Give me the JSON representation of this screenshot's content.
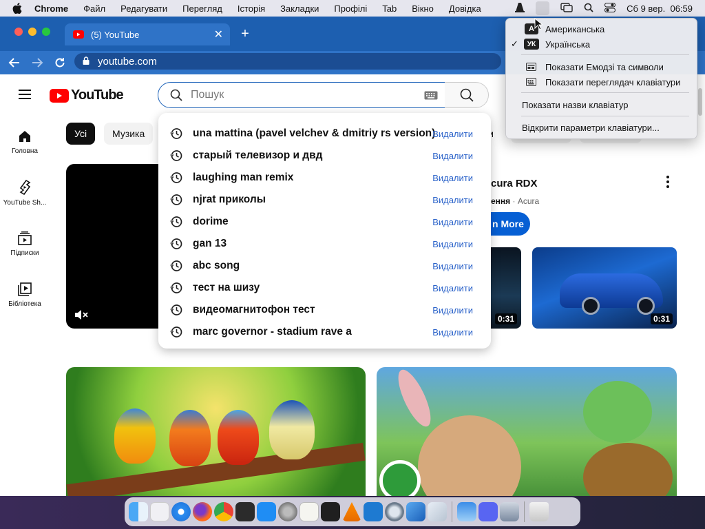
{
  "menubar": {
    "items": [
      "Chrome",
      "Файл",
      "Редагувати",
      "Перегляд",
      "Історія",
      "Закладки",
      "Профілі",
      "Tab",
      "Вікно",
      "Довідка"
    ],
    "clock": "Сб 9 вер.  06:59"
  },
  "tab": {
    "title": "(5) YouTube"
  },
  "address": {
    "url": "youtube.com"
  },
  "youtube": {
    "logo": "YouTube",
    "search_placeholder": "Пошук",
    "sidebar": [
      {
        "label": "Головна"
      },
      {
        "label": "YouTube Sh..."
      },
      {
        "label": "Підписки"
      },
      {
        "label": "Бібліотека"
      }
    ],
    "chips": [
      "Усі",
      "Музика"
    ],
    "partial_chip": "ли",
    "suggestions": [
      {
        "text": "una mattina (pavel velchev & dmitriy rs version)",
        "action": "Видалити"
      },
      {
        "text": "старый телевизор и двд",
        "action": "Видалити"
      },
      {
        "text": "laughing man remix",
        "action": "Видалити"
      },
      {
        "text": "njrat приколы",
        "action": "Видалити"
      },
      {
        "text": "dorime",
        "action": "Видалити"
      },
      {
        "text": "gan 13",
        "action": "Видалити"
      },
      {
        "text": "abc song",
        "action": "Видалити"
      },
      {
        "text": "тест на шизу",
        "action": "Видалити"
      },
      {
        "text": "видеомагнитофон тест",
        "action": "Видалити"
      },
      {
        "text": "marc governor - stadium rave a",
        "action": "Видалити"
      }
    ],
    "ad": {
      "title_partial": "cura RDX",
      "sponsor_partial": "ення",
      "sponsor_name": "Acura",
      "cta_partial": "n More",
      "durations": [
        "0:31",
        "0:31"
      ]
    }
  },
  "keyboard_menu": {
    "sources": [
      {
        "badge": "A",
        "label": "Американська",
        "checked": false
      },
      {
        "badge": "УК",
        "label": "Українська",
        "checked": true
      }
    ],
    "check_mark": "✓",
    "items": [
      "Показати Емодзі та символи",
      "Показати переглядач клавіатури",
      "Показати назви клавіатур",
      "Відкрити параметри клавіатури..."
    ]
  }
}
